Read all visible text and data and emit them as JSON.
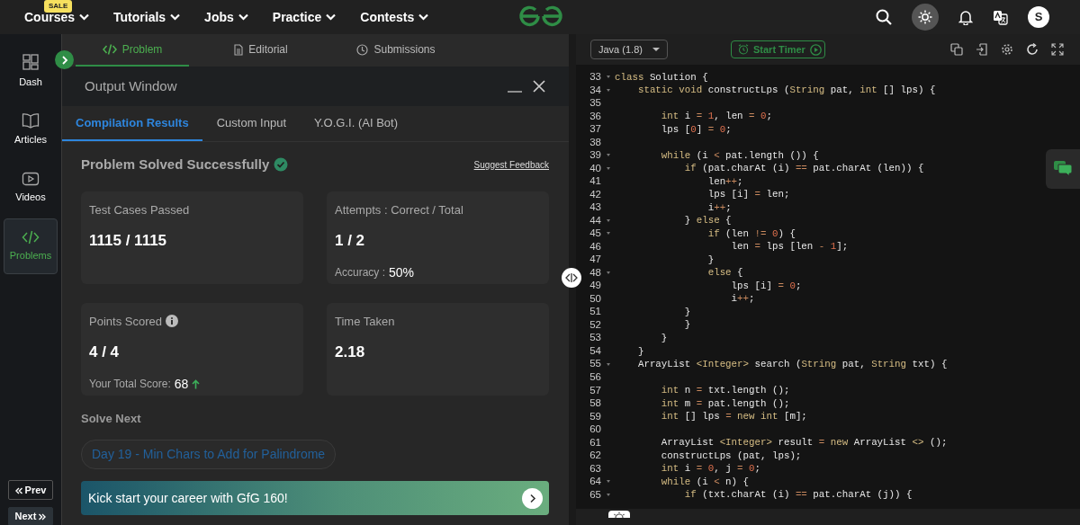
{
  "top_nav": {
    "menus": [
      {
        "label": "Courses",
        "badge": "SALE"
      },
      {
        "label": "Tutorials"
      },
      {
        "label": "Jobs"
      },
      {
        "label": "Practice"
      },
      {
        "label": "Contests"
      }
    ],
    "theme_toggle": {
      "on": true
    },
    "avatar": "S"
  },
  "sidebar": {
    "items": [
      {
        "label": "Dash",
        "selected": false
      },
      {
        "label": "Articles",
        "selected": false
      },
      {
        "label": "Videos",
        "selected": false
      },
      {
        "label": "Problems",
        "selected": true
      }
    ],
    "prev": "Prev",
    "next": "Next"
  },
  "problem_tabs": [
    {
      "label": "Problem",
      "selected": true
    },
    {
      "label": "Editorial",
      "selected": false
    },
    {
      "label": "Submissions",
      "selected": false
    }
  ],
  "output_window": {
    "title": "Output Window",
    "tabs": [
      {
        "label": "Compilation Results",
        "selected": true
      },
      {
        "label": "Custom Input",
        "selected": false
      },
      {
        "label": "Y.O.G.I. (AI Bot)",
        "selected": false
      }
    ],
    "status": "Problem Solved Successfully",
    "feedback_link": "Suggest Feedback",
    "stats": [
      {
        "label": "Test Cases Passed",
        "value": "1115 / 1115"
      },
      {
        "label": "Attempts : Correct / Total",
        "value": "1 / 2",
        "note_label": "Accuracy :",
        "note_value": "50%"
      },
      {
        "label": "Points Scored",
        "info": true,
        "value": "4 / 4",
        "note_label": "Your Total Score:",
        "note_value": "68",
        "trend_up": true
      },
      {
        "label": "Time Taken",
        "value": "2.18"
      }
    ],
    "solve_next": {
      "heading": "Solve Next",
      "problem": "Day 19 - Min Chars to Add for Palindrome"
    },
    "banner": "Kick start your career with GfG 160!"
  },
  "editor": {
    "language": "Java (1.8)",
    "timer_button": "Start Timer",
    "lines": [
      {
        "num": "33",
        "fold": true,
        "tokens": [
          {
            "kind": "keyword",
            "text": "class"
          },
          {
            "kind": "plain",
            "text": " Solution {"
          }
        ]
      },
      {
        "num": "34",
        "fold": true,
        "tokens": [
          {
            "kind": "keyword",
            "text": "    static void"
          },
          {
            "kind": "plain",
            "text": " constructLps ("
          },
          {
            "kind": "keyword",
            "text": "String"
          },
          {
            "kind": "plain",
            "text": " pat, "
          },
          {
            "kind": "keyword",
            "text": "int"
          },
          {
            "kind": "plain",
            "text": " [] lps) {"
          }
        ]
      },
      {
        "num": "35",
        "fold": false
      },
      {
        "num": "36",
        "fold": false,
        "tokens": [
          {
            "kind": "keyword",
            "text": "        int"
          },
          {
            "kind": "plain",
            "text": " i "
          },
          {
            "kind": "operator",
            "text": "="
          },
          {
            "kind": "number",
            "text": " 1"
          },
          {
            "kind": "plain",
            "text": ", len "
          },
          {
            "kind": "operator",
            "text": "="
          },
          {
            "kind": "number",
            "text": " 0"
          },
          {
            "kind": "plain",
            "text": ";"
          }
        ]
      },
      {
        "num": "37",
        "fold": false,
        "tokens": [
          {
            "kind": "plain",
            "text": "        lps ["
          },
          {
            "kind": "number",
            "text": "0"
          },
          {
            "kind": "plain",
            "text": "] "
          },
          {
            "kind": "operator",
            "text": "="
          },
          {
            "kind": "number",
            "text": " 0"
          },
          {
            "kind": "plain",
            "text": ";"
          }
        ]
      },
      {
        "num": "38",
        "fold": false
      },
      {
        "num": "39",
        "fold": true,
        "tokens": [
          {
            "kind": "keyword",
            "text": "        while"
          },
          {
            "kind": "plain",
            "text": " (i "
          },
          {
            "kind": "operator",
            "text": "<"
          },
          {
            "kind": "plain",
            "text": " pat.length ()) {"
          }
        ]
      },
      {
        "num": "40",
        "fold": true,
        "tokens": [
          {
            "kind": "keyword",
            "text": "            if"
          },
          {
            "kind": "plain",
            "text": " (pat.charAt (i) "
          },
          {
            "kind": "operator",
            "text": "=="
          },
          {
            "kind": "plain",
            "text": " pat.charAt (len)) {"
          }
        ]
      },
      {
        "num": "41",
        "fold": false,
        "tokens": [
          {
            "kind": "plain",
            "text": "                len"
          },
          {
            "kind": "operator",
            "text": "++"
          },
          {
            "kind": "plain",
            "text": ";"
          }
        ]
      },
      {
        "num": "42",
        "fold": false,
        "tokens": [
          {
            "kind": "plain",
            "text": "                lps [i] "
          },
          {
            "kind": "operator",
            "text": "="
          },
          {
            "kind": "plain",
            "text": " len;"
          }
        ]
      },
      {
        "num": "43",
        "fold": false,
        "tokens": [
          {
            "kind": "plain",
            "text": "                i"
          },
          {
            "kind": "operator",
            "text": "++"
          },
          {
            "kind": "plain",
            "text": ";"
          }
        ]
      },
      {
        "num": "44",
        "fold": true,
        "tokens": [
          {
            "kind": "plain",
            "text": "            } "
          },
          {
            "kind": "keyword",
            "text": "else"
          },
          {
            "kind": "plain",
            "text": " {"
          }
        ]
      },
      {
        "num": "45",
        "fold": true,
        "tokens": [
          {
            "kind": "keyword",
            "text": "                if"
          },
          {
            "kind": "plain",
            "text": " (len "
          },
          {
            "kind": "operator",
            "text": "!="
          },
          {
            "kind": "number",
            "text": " 0"
          },
          {
            "kind": "plain",
            "text": ") {"
          }
        ]
      },
      {
        "num": "46",
        "fold": false,
        "tokens": [
          {
            "kind": "plain",
            "text": "                    len "
          },
          {
            "kind": "operator",
            "text": "="
          },
          {
            "kind": "plain",
            "text": " lps [len "
          },
          {
            "kind": "operator",
            "text": "-"
          },
          {
            "kind": "number",
            "text": " 1"
          },
          {
            "kind": "plain",
            "text": "];"
          }
        ]
      },
      {
        "num": "47",
        "fold": false,
        "tokens": [
          {
            "kind": "plain",
            "text": "                }"
          }
        ]
      },
      {
        "num": "48",
        "fold": true,
        "tokens": [
          {
            "kind": "keyword",
            "text": "                else"
          },
          {
            "kind": "plain",
            "text": " {"
          }
        ]
      },
      {
        "num": "49",
        "fold": false,
        "tokens": [
          {
            "kind": "plain",
            "text": "                    lps [i] "
          },
          {
            "kind": "operator",
            "text": "="
          },
          {
            "kind": "number",
            "text": " 0"
          },
          {
            "kind": "plain",
            "text": ";"
          }
        ]
      },
      {
        "num": "50",
        "fold": false,
        "tokens": [
          {
            "kind": "plain",
            "text": "                    i"
          },
          {
            "kind": "operator",
            "text": "++"
          },
          {
            "kind": "plain",
            "text": ";"
          }
        ]
      },
      {
        "num": "51",
        "fold": false,
        "tokens": [
          {
            "kind": "plain",
            "text": "            }"
          }
        ]
      },
      {
        "num": "52",
        "fold": false,
        "tokens": [
          {
            "kind": "plain",
            "text": "            }"
          }
        ]
      },
      {
        "num": "53",
        "fold": false,
        "tokens": [
          {
            "kind": "plain",
            "text": "        }"
          }
        ]
      },
      {
        "num": "54",
        "fold": false,
        "tokens": [
          {
            "kind": "plain",
            "text": "    }"
          }
        ]
      },
      {
        "num": "55",
        "fold": true,
        "tokens": [
          {
            "kind": "plain",
            "text": "    ArrayList "
          },
          {
            "kind": "keyword",
            "text": "<Integer>"
          },
          {
            "kind": "plain",
            "text": " search ("
          },
          {
            "kind": "keyword",
            "text": "String"
          },
          {
            "kind": "plain",
            "text": " pat, "
          },
          {
            "kind": "keyword",
            "text": "String"
          },
          {
            "kind": "plain",
            "text": " txt) {"
          }
        ]
      },
      {
        "num": "56",
        "fold": false
      },
      {
        "num": "57",
        "fold": false,
        "tokens": [
          {
            "kind": "keyword",
            "text": "        int"
          },
          {
            "kind": "plain",
            "text": " n "
          },
          {
            "kind": "operator",
            "text": "="
          },
          {
            "kind": "plain",
            "text": " txt.length ();"
          }
        ]
      },
      {
        "num": "58",
        "fold": false,
        "tokens": [
          {
            "kind": "keyword",
            "text": "        int"
          },
          {
            "kind": "plain",
            "text": " m "
          },
          {
            "kind": "operator",
            "text": "="
          },
          {
            "kind": "plain",
            "text": " pat.length ();"
          }
        ]
      },
      {
        "num": "59",
        "fold": false,
        "tokens": [
          {
            "kind": "keyword",
            "text": "        int"
          },
          {
            "kind": "plain",
            "text": " [] lps "
          },
          {
            "kind": "operator",
            "text": "="
          },
          {
            "kind": "keyword",
            "text": " new int"
          },
          {
            "kind": "plain",
            "text": " [m];"
          }
        ]
      },
      {
        "num": "60",
        "fold": false
      },
      {
        "num": "61",
        "fold": false,
        "tokens": [
          {
            "kind": "plain",
            "text": "        ArrayList "
          },
          {
            "kind": "keyword",
            "text": "<Integer>"
          },
          {
            "kind": "plain",
            "text": " result "
          },
          {
            "kind": "operator",
            "text": "="
          },
          {
            "kind": "keyword",
            "text": " new"
          },
          {
            "kind": "plain",
            "text": " ArrayList "
          },
          {
            "kind": "keyword",
            "text": "<>"
          },
          {
            "kind": "plain",
            "text": " ();"
          }
        ]
      },
      {
        "num": "62",
        "fold": false,
        "tokens": [
          {
            "kind": "plain",
            "text": "        constructLps (pat, lps);"
          }
        ]
      },
      {
        "num": "63",
        "fold": false,
        "tokens": [
          {
            "kind": "keyword",
            "text": "        int"
          },
          {
            "kind": "plain",
            "text": " i "
          },
          {
            "kind": "operator",
            "text": "="
          },
          {
            "kind": "number",
            "text": " 0"
          },
          {
            "kind": "plain",
            "text": ", j "
          },
          {
            "kind": "operator",
            "text": "="
          },
          {
            "kind": "number",
            "text": " 0"
          },
          {
            "kind": "plain",
            "text": ";"
          }
        ]
      },
      {
        "num": "64",
        "fold": true,
        "tokens": [
          {
            "kind": "keyword",
            "text": "        while"
          },
          {
            "kind": "plain",
            "text": " (i "
          },
          {
            "kind": "operator",
            "text": "<"
          },
          {
            "kind": "plain",
            "text": " n) {"
          }
        ]
      },
      {
        "num": "65",
        "fold": true,
        "tokens": [
          {
            "kind": "keyword",
            "text": "            if"
          },
          {
            "kind": "plain",
            "text": " (txt.charAt (i) "
          },
          {
            "kind": "operator",
            "text": "=="
          },
          {
            "kind": "plain",
            "text": " pat.charAt (j)) {"
          }
        ]
      }
    ]
  }
}
